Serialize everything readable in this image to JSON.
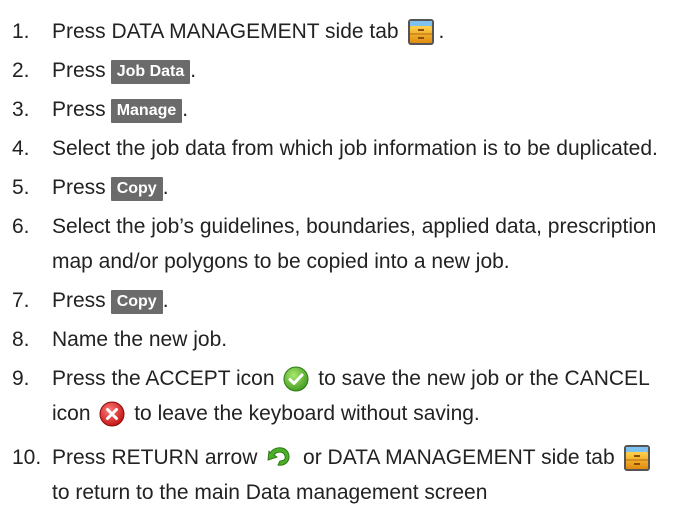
{
  "steps": [
    {
      "num": "1.",
      "pre": "Press DATA MANAGEMENT side tab",
      "icon": "folder-cabinet-icon",
      "post": "."
    },
    {
      "num": "2.",
      "pre": "Press",
      "button": "Job Data",
      "post": "."
    },
    {
      "num": "3.",
      "pre": "Press",
      "button": "Manage",
      "post": "."
    },
    {
      "num": "4.",
      "text": "Select the job data from which job information is to be duplicated."
    },
    {
      "num": "5.",
      "pre": "Press",
      "button": "Copy",
      "post": "."
    },
    {
      "num": "6.",
      "line1": "Select the job’s guidelines, boundaries, applied data, prescription",
      "line2": "map and/or polygons to be copied into a new job."
    },
    {
      "num": "7.",
      "pre": "Press",
      "button": "Copy",
      "post": "."
    },
    {
      "num": "8.",
      "text": "Name the new job."
    },
    {
      "num": "9.",
      "line1_pre": "Press the ACCEPT icon",
      "accept_icon": "check-circle-icon",
      "line1_post": "to save the new job or the CANCEL",
      "line2_pre": "icon",
      "cancel_icon": "x-circle-icon",
      "line2_post": "to leave the keyboard without saving."
    },
    {
      "num": "10.",
      "line1_pre": "Press RETURN arrow",
      "return_icon": "return-arrow-icon",
      "line1_mid": "or DATA MANAGEMENT side tab",
      "tab_icon": "folder-cabinet-icon",
      "line2": "to return to the main Data management screen"
    }
  ],
  "colors": {
    "button_bg": "#6b6b6b",
    "accept": "#5cb82e",
    "cancel": "#e02424",
    "return": "#4caf2a",
    "cabinet": "#f0a020"
  }
}
